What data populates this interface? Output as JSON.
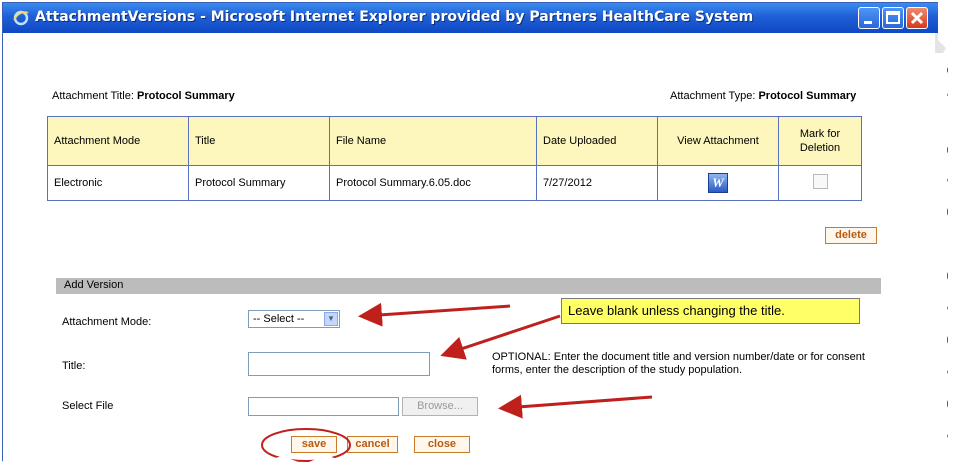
{
  "window": {
    "title": "AttachmentVersions - Microsoft Internet Explorer provided by Partners HealthCare System",
    "icon": "ie-icon"
  },
  "header": {
    "attachment_title_label": "Attachment Title:",
    "attachment_title_value": "Protocol Summary",
    "attachment_type_label": "Attachment Type:",
    "attachment_type_value": "Protocol Summary"
  },
  "table": {
    "columns": [
      "Attachment Mode",
      "Title",
      "File Name",
      "Date Uploaded",
      "View Attachment",
      "Mark for Deletion"
    ],
    "rows": [
      {
        "mode": "Electronic",
        "title": "Protocol Summary",
        "file_name": "Protocol Summary.6.05.doc",
        "date": "7/27/2012",
        "view_icon": "word-document-icon",
        "view_icon_glyph": "W",
        "mark_checked": false
      }
    ]
  },
  "delete_button": "delete",
  "add_version": {
    "section_title": "Add Version",
    "mode_label": "Attachment Mode:",
    "mode_select_value": "-- Select --",
    "title_label": "Title:",
    "title_value": "",
    "file_label": "Select File",
    "file_value": "",
    "browse_label": "Browse...",
    "optional_note": "OPTIONAL: Enter the document title and version number/date or for consent forms, enter the description of the study population."
  },
  "buttons": {
    "save": "save",
    "cancel": "cancel",
    "close": "close"
  },
  "callout": "Leave blank unless changing the title.",
  "colors": {
    "titlebar": "#1f5fd6",
    "table_header_bg": "#fdf6bd",
    "table_border": "#5a70c0",
    "button_text": "#b85a10",
    "callout_bg": "#ffff66",
    "annotation_red": "#c0201c"
  }
}
